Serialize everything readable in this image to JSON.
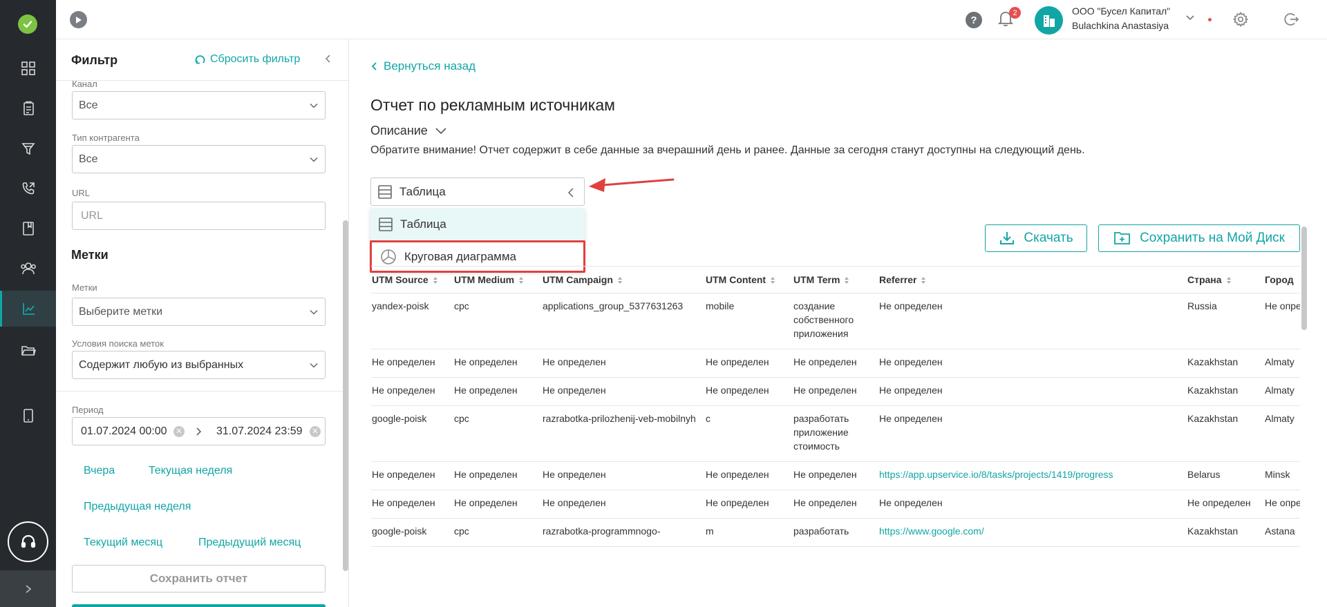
{
  "header": {
    "company_name": "ООО \"Бусел Капитал\"",
    "user_name": "Bulachkina Anastasiya",
    "notifications_count": "2",
    "help_label": "?"
  },
  "filter": {
    "title": "Фильтр",
    "reset_label": "Сбросить фильтр",
    "channel_label": "Канал",
    "channel_value": "Все",
    "contractor_label": "Тип контрагента",
    "contractor_value": "Все",
    "url_label": "URL",
    "url_placeholder": "URL",
    "tags_section": "Метки",
    "tags_label": "Метки",
    "tags_placeholder": "Выберите метки",
    "tag_conditions_label": "Условия поиска меток",
    "tag_conditions_value": "Содержит любую из выбранных",
    "period_label": "Период",
    "date_from": "01.07.2024 00:00",
    "date_to": "31.07.2024 23:59",
    "presets": {
      "yesterday": "Вчера",
      "this_week": "Текущая неделя",
      "prev_week": "Предыдущая неделя",
      "this_month": "Текущий месяц",
      "prev_month": "Предыдущий месяц"
    },
    "save_report_label": "Сохранить отчет"
  },
  "main": {
    "back_label": "Вернуться назад",
    "title": "Отчет по рекламным источникам",
    "description_toggle": "Описание",
    "notice": "Обратите внимание! Отчет содержит в себе данные за вчерашний день и ранее. Данные за сегодня станут доступны на следующий день.",
    "view_select_value": "Таблица",
    "view_options": [
      "Таблица",
      "Круговая диаграмма"
    ],
    "download_label": "Скачать",
    "save_disk_label": "Сохранить на Мой Диск"
  },
  "table": {
    "columns": [
      "UTM Source",
      "UTM Medium",
      "UTM Campaign",
      "UTM Content",
      "UTM Term",
      "Referrer",
      "Страна",
      "Город"
    ],
    "rows": [
      [
        "yandex-poisk",
        "cpc",
        "applications_group_5377631263",
        "mobile",
        "создание собственного приложения",
        "Не определен",
        "Russia",
        "Не определен"
      ],
      [
        "Не определен",
        "Не определен",
        "Не определен",
        "Не определен",
        "Не определен",
        "Не определен",
        "Kazakhstan",
        "Almaty"
      ],
      [
        "Не определен",
        "Не определен",
        "Не определен",
        "Не определен",
        "Не определен",
        "Не определен",
        "Kazakhstan",
        "Almaty"
      ],
      [
        "google-poisk",
        "cpc",
        "razrabotka-prilozhenij-veb-mobilnyh",
        "c",
        "разработать приложение стоимость",
        "Не определен",
        "Kazakhstan",
        "Almaty"
      ],
      [
        "Не определен",
        "Не определен",
        "Не определен",
        "Не определен",
        "Не определен",
        "https://app.upservice.io/8/tasks/projects/1419/progress",
        "Belarus",
        "Minsk"
      ],
      [
        "Не определен",
        "Не определен",
        "Не определен",
        "Не определен",
        "Не определен",
        "Не определен",
        "Не определен",
        "Не определен"
      ],
      [
        "google-poisk",
        "cpc",
        "razrabotka-programmnogo-",
        "m",
        "разработать",
        "https://www.google.com/",
        "Kazakhstan",
        "Astana"
      ]
    ]
  },
  "colors": {
    "accent": "#12a5a5",
    "rail": "#262a2e",
    "highlight_red": "#e0403f"
  }
}
